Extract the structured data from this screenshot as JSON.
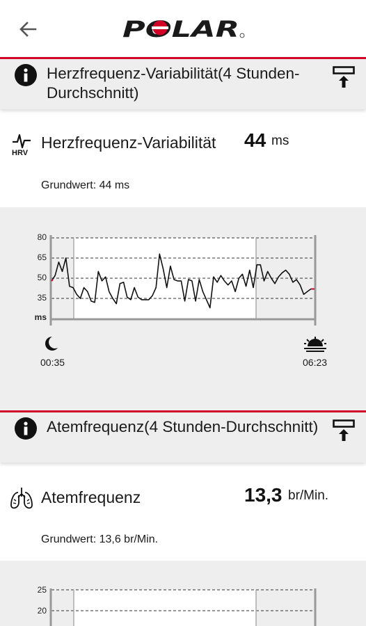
{
  "header": {
    "back_icon": "arrow-left-icon",
    "brand": "POLAR",
    "brand_color": "#d10027"
  },
  "hrv_section": {
    "title": "Herzfrequenz-Variabilität(4 Stunden-Durchschnitt)",
    "info_icon": "info-icon",
    "pin_icon": "pin-icon",
    "metric_icon": "hrv-icon",
    "metric_icon_text": "HRV",
    "label": "Herzfrequenz-Variabilität",
    "value": "44",
    "unit": "ms",
    "baseline": "Grundwert: 44 ms"
  },
  "hrv_chart": {
    "type": "line",
    "y_unit": "ms",
    "yticks": [
      "80",
      "65",
      "50",
      "35"
    ],
    "ylim": [
      20,
      80
    ],
    "start_label": "00:35",
    "end_label": "06:23",
    "start_icon": "moon-icon",
    "end_icon": "sunrise-icon",
    "line_color": "#111111",
    "edge_color": "#d10027",
    "grid": "dashed"
  },
  "resp_section": {
    "title": "Atemfrequenz(4 Stunden-Durchschnitt)",
    "info_icon": "info-icon",
    "pin_icon": "pin-icon",
    "metric_icon": "lungs-icon",
    "label": "Atemfrequenz",
    "value": "13,3",
    "unit": "br/Min.",
    "baseline": "Grundwert: 13,6 br/Min."
  },
  "resp_chart": {
    "type": "line",
    "yticks": [
      "25",
      "20"
    ],
    "grid": "dashed"
  },
  "chart_data": [
    {
      "type": "line",
      "title": "",
      "ylabel": "ms",
      "ylim": [
        20,
        80
      ],
      "x_start": "00:35",
      "x_end": "06:23",
      "series": [
        {
          "values": [
            48,
            52,
            62,
            55,
            65,
            44,
            43,
            38,
            35,
            43,
            40,
            33,
            32,
            55,
            48,
            51,
            40,
            35,
            31,
            46,
            47,
            36,
            34,
            43,
            36,
            34,
            34,
            34,
            37,
            43,
            68,
            57,
            43,
            59,
            49,
            48,
            48,
            33,
            49,
            48,
            33,
            49,
            40,
            34,
            28,
            51,
            47,
            52,
            48,
            45,
            48,
            40,
            50,
            53,
            44,
            56,
            43,
            60,
            60,
            48,
            55,
            50,
            46,
            51,
            54,
            56,
            53,
            47,
            49,
            45,
            38,
            40,
            42,
            42
          ]
        }
      ]
    },
    {
      "type": "line",
      "title": "",
      "yticks": [
        25,
        20
      ],
      "series": []
    }
  ]
}
